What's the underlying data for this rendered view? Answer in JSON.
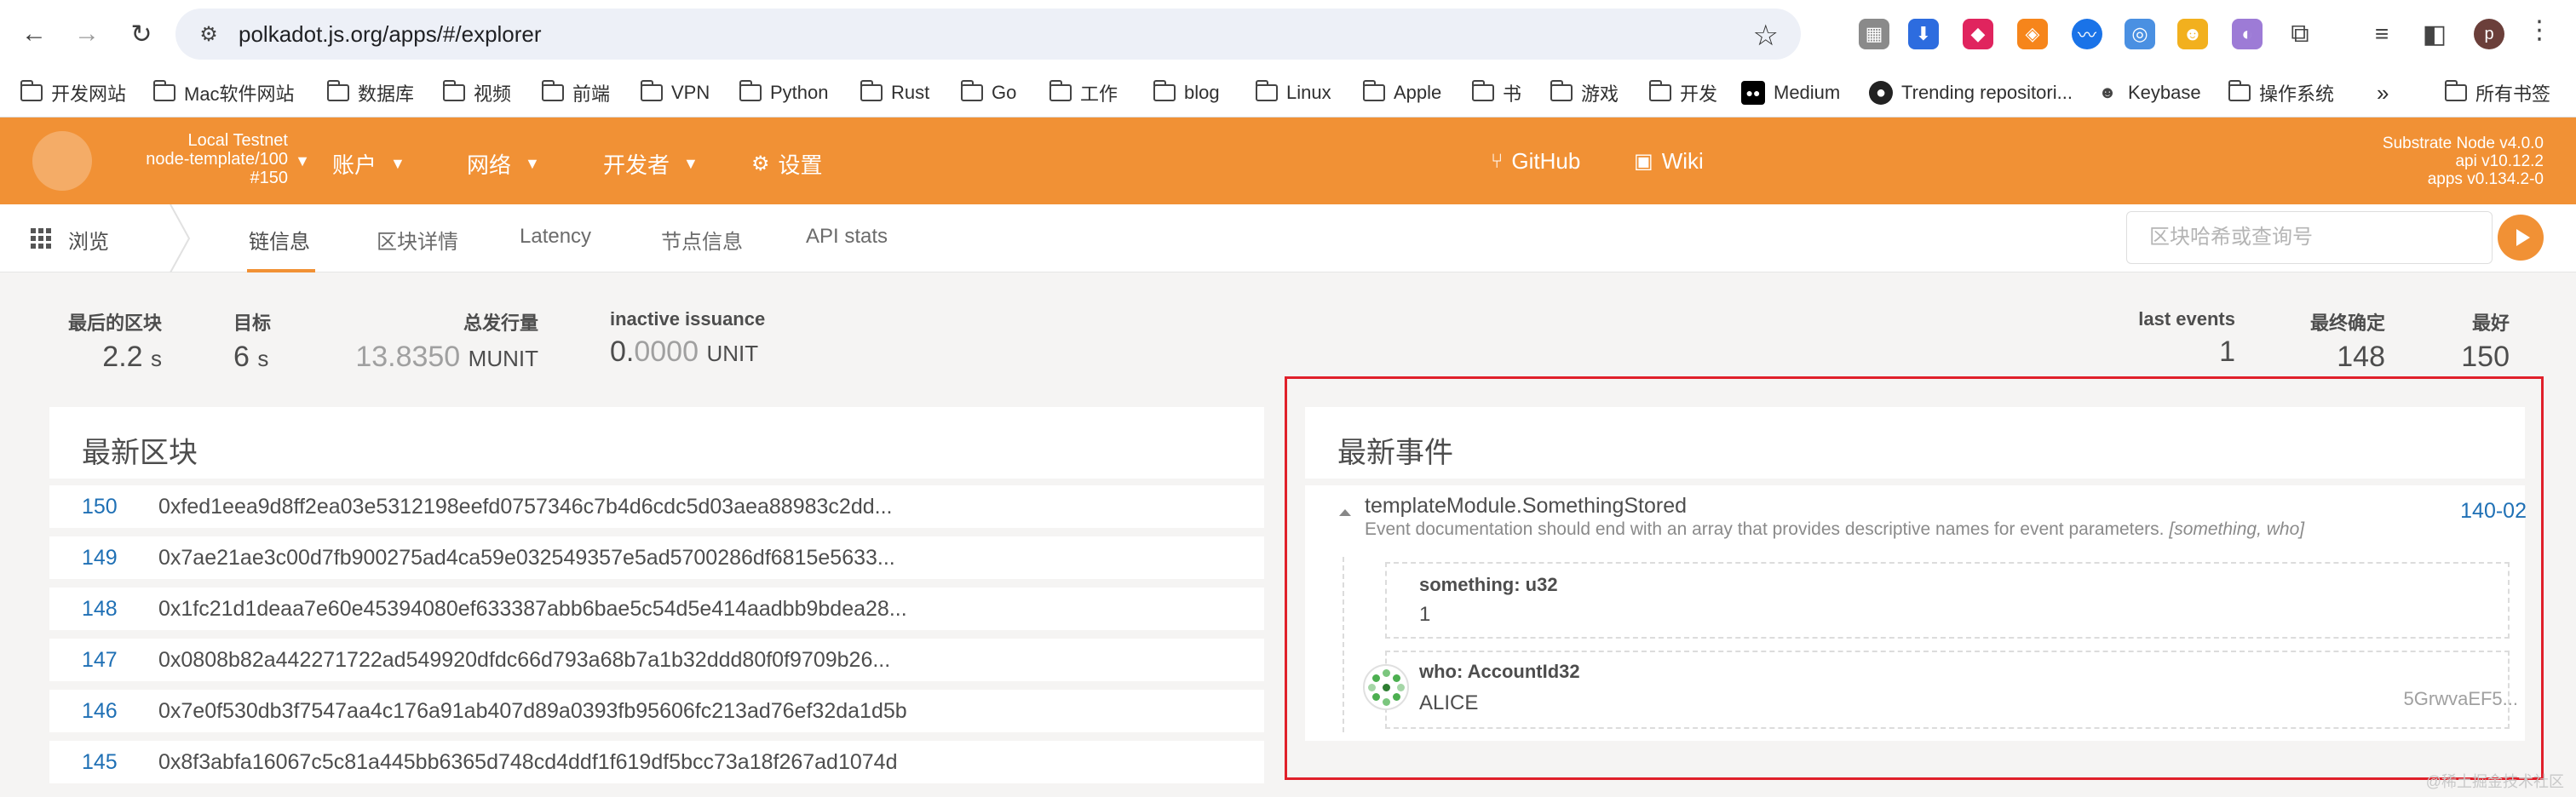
{
  "browser": {
    "url": "polkadot.js.org/apps/#/explorer",
    "profile_initial": "p",
    "bookmarks": [
      "开发网站",
      "Mac软件网站",
      "数据库",
      "视频",
      "前端",
      "VPN",
      "Python",
      "Rust",
      "Go",
      "工作",
      "blog",
      "Linux",
      "Apple",
      "书",
      "游戏",
      "开发",
      "Medium",
      "Trending repositori...",
      "Keybase",
      "操作系统",
      "所有书签"
    ]
  },
  "header": {
    "chain_name": "Local Testnet",
    "chain_node": "node-template/100",
    "chain_block": "#150",
    "menu": [
      "账户",
      "网络",
      "开发者",
      "设置"
    ],
    "links": [
      "GitHub",
      "Wiki"
    ],
    "version": [
      "Substrate Node v4.0.0",
      "api v10.12.2",
      "apps v0.134.2-0"
    ]
  },
  "tabs": {
    "browse": "浏览",
    "items": [
      "链信息",
      "区块详情",
      "Latency",
      "节点信息",
      "API stats"
    ],
    "active": "链信息",
    "search_placeholder": "区块哈希或查询号"
  },
  "summary": {
    "last_block": {
      "label": "最后的区块",
      "value": "2.2",
      "unit": "s"
    },
    "target": {
      "label": "目标",
      "value": "6",
      "unit": "s"
    },
    "total_issuance": {
      "label": "总发行量",
      "value_main": "13.",
      "value_light": "8350",
      "unit": "MUNIT"
    },
    "inactive_issuance": {
      "label": "inactive issuance",
      "value_main": "0.",
      "value_light": "0000",
      "unit": "UNIT"
    },
    "last_events": {
      "label": "last events",
      "value": "1"
    },
    "finalized": {
      "label": "最终确定",
      "value": "148"
    },
    "best": {
      "label": "最好",
      "value": "150"
    }
  },
  "blocks": {
    "title": "最新区块",
    "rows": [
      {
        "number": "150",
        "hash": "0xfed1eea9d8ff2ea03e5312198eefd0757346c7b4d6cdc5d03aea88983c2dd..."
      },
      {
        "number": "149",
        "hash": "0x7ae21ae3c00d7fb900275ad4ca59e032549357e5ad5700286df6815e5633..."
      },
      {
        "number": "148",
        "hash": "0x1fc21d1deaa7e60e45394080ef633387abb6bae5c54d5e414aadbb9bdea28..."
      },
      {
        "number": "147",
        "hash": "0x0808b82a442271722ad549920dfdc66d793a68b7a1b32ddd80f0f9709b26..."
      },
      {
        "number": "146",
        "hash": "0x7e0f530db3f7547aa4c176a91ab407d89a0393fb95606fc213ad76ef32da1d5b"
      },
      {
        "number": "145",
        "hash": "0x8f3abfa16067c5c81a445bb6365d748cd4ddf1f619df5bcc73a18f267ad1074d"
      }
    ]
  },
  "events": {
    "title": "最新事件",
    "name": "templateModule.SomethingStored",
    "doc": "Event documentation should end with an array that provides descriptive names for event parameters.",
    "params_hint": "[something, who]",
    "id": "140-02",
    "params": [
      {
        "label": "something: u32",
        "value": "1"
      },
      {
        "label": "who: AccountId32",
        "value": "ALICE",
        "address": "5GrwvaEF5..."
      }
    ]
  },
  "watermark": "@稀土掘金技术社区"
}
